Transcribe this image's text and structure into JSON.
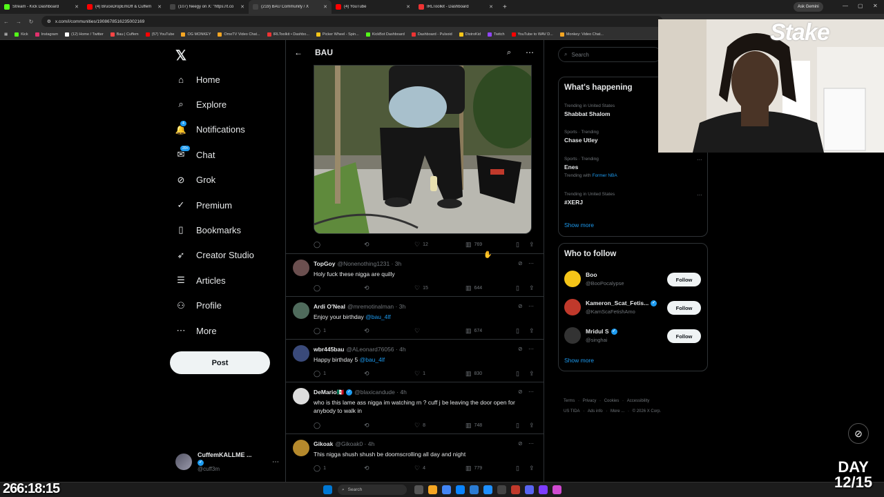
{
  "browser": {
    "tabs": [
      {
        "label": "Stream - Kick Dashboard",
        "icon": "kick-icon",
        "color": "#53fc18",
        "active": false
      },
      {
        "label": "(4) BruceDropEmOff & Cuffem",
        "icon": "youtube-icon",
        "color": "#ff0000",
        "active": false
      },
      {
        "label": "(107) Neegy on X: \"https://t.co",
        "icon": "x-icon",
        "color": "#000000",
        "active": false
      },
      {
        "label": "(219) BAU Community / X",
        "icon": "x-icon",
        "color": "#000000",
        "active": true
      },
      {
        "label": "(4) YouTube",
        "icon": "youtube-icon",
        "color": "#ff0000",
        "active": false
      },
      {
        "label": "IRLToolkit - Dashboard",
        "icon": "irltoolkit-icon",
        "color": "#e33",
        "active": false
      }
    ],
    "new_tab": "+",
    "ask_gemini": "Ask Gemini",
    "url": "x.com/i/communities/1908678516235002169",
    "bookmarks": [
      {
        "label": "Kick",
        "color": "#53fc18"
      },
      {
        "label": "Instagram",
        "color": "#e1306c"
      },
      {
        "label": "(12) Home / Twitter",
        "color": "#ffffff"
      },
      {
        "label": "Bau | Cuffem",
        "color": "#ff4444"
      },
      {
        "label": "(57) YouTube",
        "color": "#ff0000"
      },
      {
        "label": "OG MONKEY",
        "color": "#f5a623"
      },
      {
        "label": "OmeTV Video Chat...",
        "color": "#f5a623"
      },
      {
        "label": "IRLToolkit • Dashbo...",
        "color": "#e33"
      },
      {
        "label": "Picker Wheel - Spin...",
        "color": "#f5c518"
      },
      {
        "label": "KickBot Dashboard",
        "color": "#53fc18"
      },
      {
        "label": "Dashboard - Pulsoid",
        "color": "#e33"
      },
      {
        "label": "DistroKid",
        "color": "#f5c518"
      },
      {
        "label": "Twitch",
        "color": "#9146ff"
      },
      {
        "label": "YouTube to WAV D...",
        "color": "#ff0000"
      },
      {
        "label": "Monkey: Video Chat...",
        "color": "#f5a623"
      }
    ]
  },
  "nav": {
    "items": [
      {
        "label": "Home",
        "icon": "home-icon",
        "glyph": "⌂"
      },
      {
        "label": "Explore",
        "icon": "search-icon",
        "glyph": "⌕"
      },
      {
        "label": "Notifications",
        "icon": "bell-icon",
        "glyph": "🔔",
        "badge": "4"
      },
      {
        "label": "Chat",
        "icon": "chat-icon",
        "glyph": "✉",
        "badge": "20+"
      },
      {
        "label": "Grok",
        "icon": "grok-icon",
        "glyph": "⊘"
      },
      {
        "label": "Premium",
        "icon": "premium-icon",
        "glyph": "✓"
      },
      {
        "label": "Bookmarks",
        "icon": "bookmark-icon",
        "glyph": "▯"
      },
      {
        "label": "Creator Studio",
        "icon": "rocket-icon",
        "glyph": "➶"
      },
      {
        "label": "Articles",
        "icon": "article-icon",
        "glyph": "☰"
      },
      {
        "label": "Profile",
        "icon": "person-icon",
        "glyph": "⚇"
      },
      {
        "label": "More",
        "icon": "more-circle-icon",
        "glyph": "⋯"
      }
    ],
    "post_label": "Post",
    "account": {
      "name": "CuffemKALLME ...",
      "handle": "@cuff3m"
    }
  },
  "community": {
    "title": "BAU",
    "main_post": {
      "replies": "",
      "reposts": "",
      "likes": "12",
      "views": "769"
    },
    "replies": [
      {
        "name": "TopGoy",
        "handle": "@Nonenothing1231",
        "time": "3h",
        "verified": false,
        "text": "Holy fuck these nigga are quilly",
        "mention": "",
        "replies": "",
        "likes": "15",
        "views": "644",
        "avatar": "#6b4f4f"
      },
      {
        "name": "Ardi O'Neal",
        "handle": "@mremotinalman",
        "time": "3h",
        "verified": false,
        "text": "Enjoy your birthday ",
        "mention": "@bau_4lf",
        "replies": "1",
        "likes": "",
        "views": "674",
        "avatar": "#4f6b5c"
      },
      {
        "name": "wbr445bau",
        "handle": "@ALeonard76056",
        "time": "4h",
        "verified": false,
        "text": "Happy birthday 5 ",
        "mention": "@bau_4lf",
        "replies": "1",
        "likes": "1",
        "views": "830",
        "avatar": "#3a4a7a"
      },
      {
        "name": "DeMario🇲🇽",
        "handle": "@blaxicandude",
        "time": "4h",
        "verified": true,
        "text": "who is this lame ass nigga im watching rn ? cuff j be leaving the door open for anybody to walk in",
        "mention": "",
        "replies": "",
        "likes": "8",
        "views": "748",
        "avatar": "#dddddd"
      },
      {
        "name": "Gikoak",
        "handle": "@Gikoak0",
        "time": "4h",
        "verified": false,
        "text": "This nigga shush shush be doomscrolling all day and night",
        "mention": "",
        "replies": "1",
        "likes": "4",
        "views": "779",
        "avatar": "#b5892c"
      }
    ]
  },
  "right": {
    "search_placeholder": "Search",
    "happening_title": "What's happening",
    "trends": [
      {
        "meta": "Trending in United States",
        "name": "Shabbat Shalom",
        "sub": "",
        "sub_link": ""
      },
      {
        "meta": "Sports · Trending",
        "name": "Chase Utley",
        "sub": "",
        "sub_link": ""
      },
      {
        "meta": "Sports · Trending",
        "name": "Enes",
        "sub": "Trending with ",
        "sub_link": "Former NBA"
      },
      {
        "meta": "Trending in United States",
        "name": "#XERJ",
        "sub": "",
        "sub_link": ""
      }
    ],
    "show_more": "Show more",
    "who_title": "Who to follow",
    "who": [
      {
        "name": "Boo",
        "handle": "@BooPocalypse",
        "verified": false,
        "avatar": "#f5c518"
      },
      {
        "name": "Kameron_Scat_Fetis...",
        "handle": "@KamScaFetishAmo",
        "verified": true,
        "avatar": "#c0392b"
      },
      {
        "name": "Mridul S",
        "handle": "@singhai",
        "verified": true,
        "avatar": "#333333"
      }
    ],
    "follow_label": "Follow",
    "footer_line1": [
      "Terms",
      "Privacy",
      "Cookies",
      "Accessibility"
    ],
    "footer_line2": [
      "US TIDA",
      "Ads info",
      "More ...",
      "© 2026 X Corp."
    ]
  },
  "overlay": {
    "timer": "266:18:15",
    "day_label": "DAY",
    "day_count": "12/15",
    "webcam_brand": "Stake"
  },
  "taskbar": {
    "search_placeholder": "Search"
  }
}
